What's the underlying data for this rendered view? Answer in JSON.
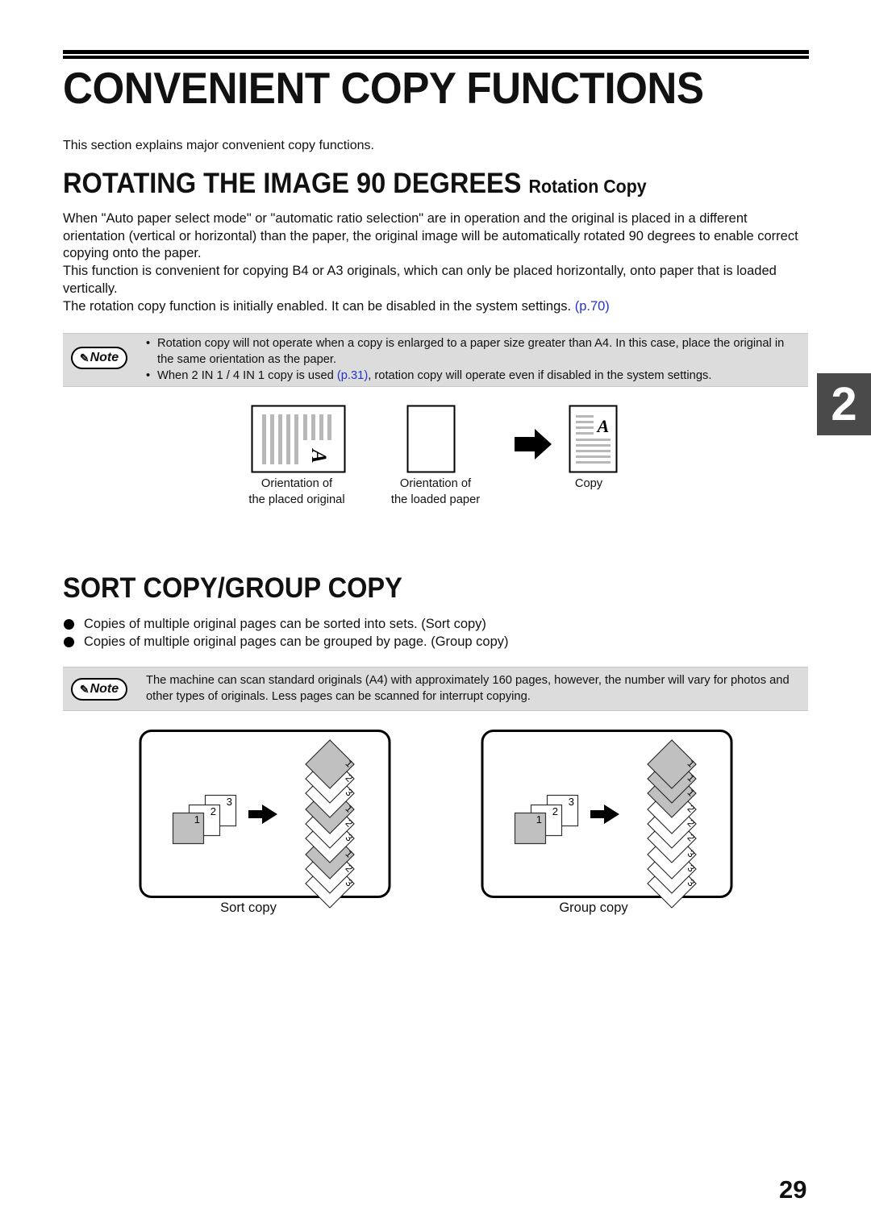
{
  "page": {
    "title": "CONVENIENT COPY FUNCTIONS",
    "intro": "This section explains major convenient copy functions.",
    "chapter_tab": "2",
    "page_number": "29"
  },
  "rotation": {
    "heading_main": "ROTATING THE IMAGE 90 DEGREES",
    "heading_sub": "Rotation Copy",
    "paragraphs": [
      "When \"Auto paper select mode\" or \"automatic ratio selection\" are in operation and the original is placed in a different orientation (vertical or horizontal) than the paper, the original image will be automatically rotated 90 degrees to enable correct copying onto the paper.",
      "This function is convenient for copying B4 or A3 originals, which can only be placed horizontally, onto paper that is loaded vertically."
    ],
    "paragraph3_text": "The rotation copy function is initially enabled. It can be disabled in the system settings.",
    "paragraph3_link": "(p.70)",
    "note": {
      "badge": "Note",
      "item1": "Rotation copy will not operate when a copy is enlarged to a paper size greater than A4. In this case, place the original in the same orientation as the paper.",
      "item2_before": "When 2 IN 1 / 4 IN 1 copy is used ",
      "item2_link": "(p.31)",
      "item2_after": ", rotation copy will operate even if disabled in the system settings."
    },
    "figure": {
      "label_original_1": "Orientation of",
      "label_original_2": "the placed original",
      "label_paper_1": "Orientation of",
      "label_paper_2": "the loaded paper",
      "label_copy": "Copy",
      "glyph": "A"
    }
  },
  "sort": {
    "heading": "SORT COPY/GROUP COPY",
    "bullets": [
      "Copies of multiple original pages can be sorted into sets. (Sort copy)",
      "Copies of multiple original pages can be grouped by page. (Group copy)"
    ],
    "note": {
      "badge": "Note",
      "text": "The machine can scan standard originals (A4) with approximately 160 pages, however, the number will vary for photos and other types of originals. Less pages can be scanned for interrupt copying."
    },
    "sort_figure": {
      "caption": "Sort copy",
      "originals": [
        "1",
        "2",
        "3"
      ],
      "output": [
        "1",
        "2",
        "3",
        "1",
        "2",
        "3",
        "1",
        "2",
        "3"
      ]
    },
    "group_figure": {
      "caption": "Group copy",
      "originals": [
        "1",
        "2",
        "3"
      ],
      "output": [
        "1",
        "1",
        "1",
        "2",
        "2",
        "2",
        "3",
        "3",
        "3"
      ]
    }
  }
}
